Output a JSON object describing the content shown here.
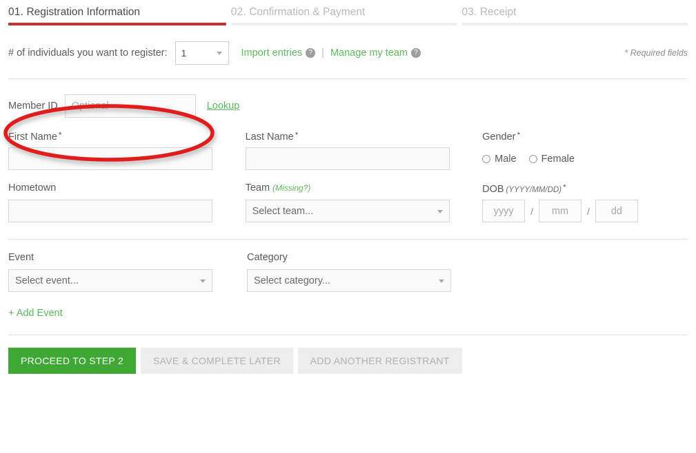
{
  "steps": [
    {
      "num": "01.",
      "label": "Registration Information",
      "state": "active"
    },
    {
      "num": "02.",
      "label": "Confirmation & Payment",
      "state": "inactive"
    },
    {
      "num": "03.",
      "label": "Receipt",
      "state": "inactive"
    }
  ],
  "count_row": {
    "label": "# of individuals you want to register:",
    "value": "1",
    "import_link": "Import entries",
    "separator": "|",
    "manage_link": "Manage my team",
    "help_icon": "question-mark-icon",
    "required_note": "* Required fields"
  },
  "member": {
    "label": "Member ID",
    "placeholder": "Optional",
    "value": "",
    "lookup_link": "Lookup"
  },
  "fields": {
    "first_name": {
      "label": "First Name",
      "required": "*",
      "value": ""
    },
    "last_name": {
      "label": "Last Name",
      "required": "*",
      "value": ""
    },
    "gender": {
      "label": "Gender",
      "required": "*",
      "options": [
        {
          "label": "Male",
          "selected": false
        },
        {
          "label": "Female",
          "selected": false
        }
      ]
    },
    "hometown": {
      "label": "Hometown",
      "value": ""
    },
    "team": {
      "label": "Team",
      "missing_link": "(Missing?)",
      "value": "Select team..."
    },
    "dob": {
      "label": "DOB",
      "format": "(YYYY/MM/DD)",
      "required": "*",
      "year_placeholder": "yyyy",
      "month_placeholder": "mm",
      "day_placeholder": "dd",
      "slash": "/"
    },
    "event": {
      "label": "Event",
      "value": "Select event..."
    },
    "category": {
      "label": "Category",
      "value": "Select category..."
    }
  },
  "add_event": "+ Add Event",
  "buttons": [
    {
      "label": "PROCEED TO STEP 2",
      "style": "primary"
    },
    {
      "label": "SAVE & COMPLETE LATER",
      "style": "muted"
    },
    {
      "label": "ADD ANOTHER REGISTRANT",
      "style": "muted"
    }
  ],
  "colors": {
    "accent_red": "#c9302c",
    "accent_green": "#5cb85c",
    "button_green": "#3fa834",
    "annotation_red": "#e01b1b"
  }
}
